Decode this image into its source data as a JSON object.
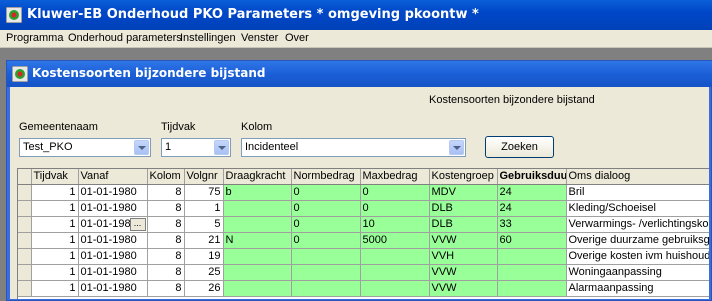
{
  "window": {
    "title": "Kluwer-EB Onderhoud PKO Parameters * omgeving pkoontw *"
  },
  "menu": [
    "Programma",
    "Onderhoud parameters",
    "Instellingen",
    "Venster",
    "Over"
  ],
  "child": {
    "title": "Kostensoorten bijzondere bijstand",
    "caption": "Kostensoorten bijzondere bijstand"
  },
  "filters": {
    "gemeente": {
      "label": "Gemeentenaam",
      "value": "Test_PKO"
    },
    "tijdvak": {
      "label": "Tijdvak",
      "value": "1"
    },
    "kolom": {
      "label": "Kolom",
      "value": "Incidenteel"
    },
    "search_label": "Zoeken"
  },
  "grid": {
    "columns": [
      "Tijdvak",
      "Vanaf",
      "Kolom",
      "Volgnr",
      "Draagkracht",
      "Normbedrag",
      "Maxbedrag",
      "Kostengroep",
      "Gebruiksduur",
      "Oms dialoog"
    ],
    "rows": [
      [
        "1",
        "01-01-1980",
        "8",
        "75",
        "b",
        "0",
        "0",
        "MDV",
        "24",
        "Bril"
      ],
      [
        "1",
        "01-01-1980",
        "8",
        "1",
        "",
        "0",
        "0",
        "DLB",
        "24",
        "Kleding/Schoeisel"
      ],
      [
        "1",
        "01-01-1980",
        "8",
        "5",
        "",
        "0",
        "10",
        "DLB",
        "33",
        "Verwarmings- /verlichtingskosten"
      ],
      [
        "1",
        "01-01-1980",
        "8",
        "21",
        "N",
        "0",
        "5000",
        "VVW",
        "60",
        "Overige duurzame gebruiksgoederen"
      ],
      [
        "1",
        "01-01-1980",
        "8",
        "19",
        "",
        "",
        "",
        "VVH",
        "",
        "Overige kosten ivm huishouding"
      ],
      [
        "1",
        "01-01-1980",
        "8",
        "25",
        "",
        "",
        "",
        "VVW",
        "",
        "Woningaanpassing"
      ],
      [
        "1",
        "01-01-1980",
        "8",
        "26",
        "",
        "",
        "",
        "VVW",
        "",
        "Alarmaanpassing"
      ]
    ],
    "ellipsis": "..."
  },
  "colors": {
    "green_cell": "#99ff99",
    "title_blue": "#0047c8"
  }
}
